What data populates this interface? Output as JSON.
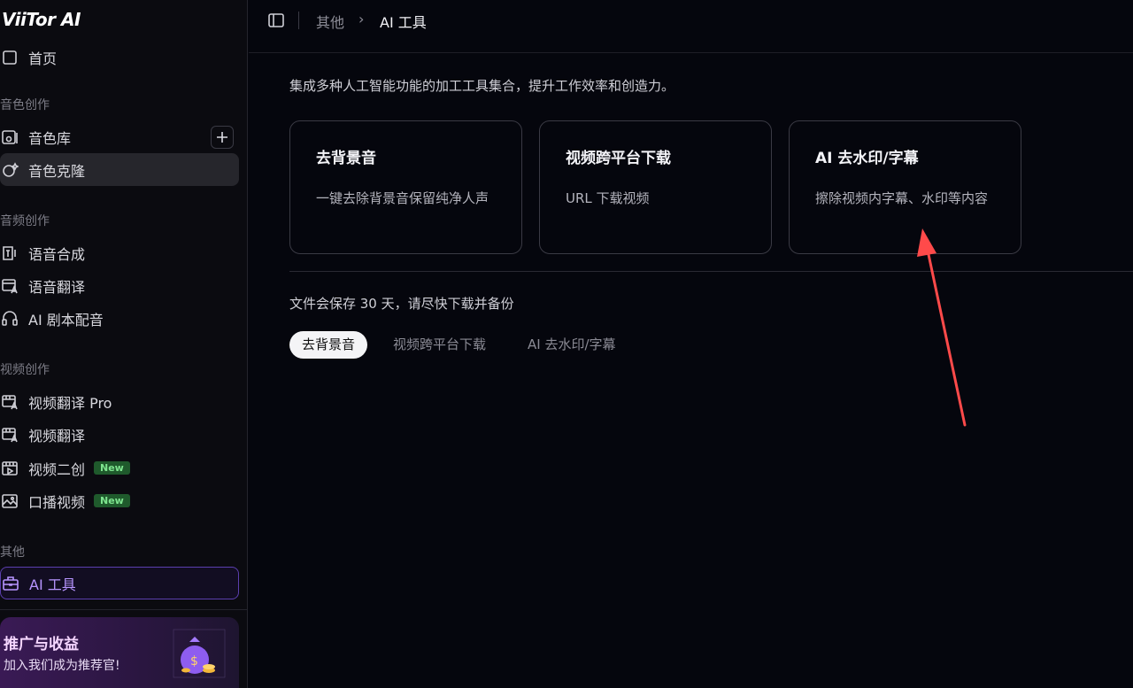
{
  "app": {
    "logo": "ViiTor AI"
  },
  "sidebar": {
    "home_partial": "首页",
    "sections": [
      {
        "label": "音色创作"
      },
      {
        "label": "音频创作"
      },
      {
        "label": "视频创作"
      },
      {
        "label": "其他"
      }
    ],
    "items": [
      {
        "label": "音色库",
        "icon": "voice-library-icon"
      },
      {
        "label": "音色克隆",
        "icon": "voice-clone-icon"
      },
      {
        "label": "语音合成",
        "icon": "speech-synthesis-icon"
      },
      {
        "label": "语音翻译",
        "icon": "speech-translate-icon"
      },
      {
        "label": "AI 剧本配音",
        "icon": "headset-icon"
      },
      {
        "label": "视频翻译 Pro",
        "icon": "video-translate-icon"
      },
      {
        "label": "视频翻译",
        "icon": "video-translate-icon"
      },
      {
        "label": "视频二创",
        "icon": "video-remix-icon",
        "badge": "New"
      },
      {
        "label": "口播视频",
        "icon": "image-icon",
        "badge": "New"
      },
      {
        "label": "AI 工具",
        "icon": "toolbox-icon"
      }
    ],
    "promo": {
      "title": "推广与收益",
      "subtitle": "加入我们成为推荐官!"
    }
  },
  "header": {
    "breadcrumb": [
      "其他",
      "AI 工具"
    ]
  },
  "main": {
    "intro": "集成多种人工智能功能的加工工具集合，提升工作效率和创造力。",
    "cards": [
      {
        "title": "去背景音",
        "desc": "一键去除背景音保留纯净人声"
      },
      {
        "title": "视频跨平台下载",
        "desc": "URL 下载视频"
      },
      {
        "title": "AI 去水印/字幕",
        "desc": "擦除视频内字幕、水印等内容"
      }
    ],
    "notice": "文件会保存 30 天，请尽快下载并备份",
    "tabs": [
      "去背景音",
      "视频跨平台下载",
      "AI 去水印/字幕"
    ],
    "active_tab": "去背景音"
  },
  "colors": {
    "accent_purple": "#b795ff",
    "badge_green": "#7ee58f",
    "annotation_red": "#ff4a4a"
  }
}
